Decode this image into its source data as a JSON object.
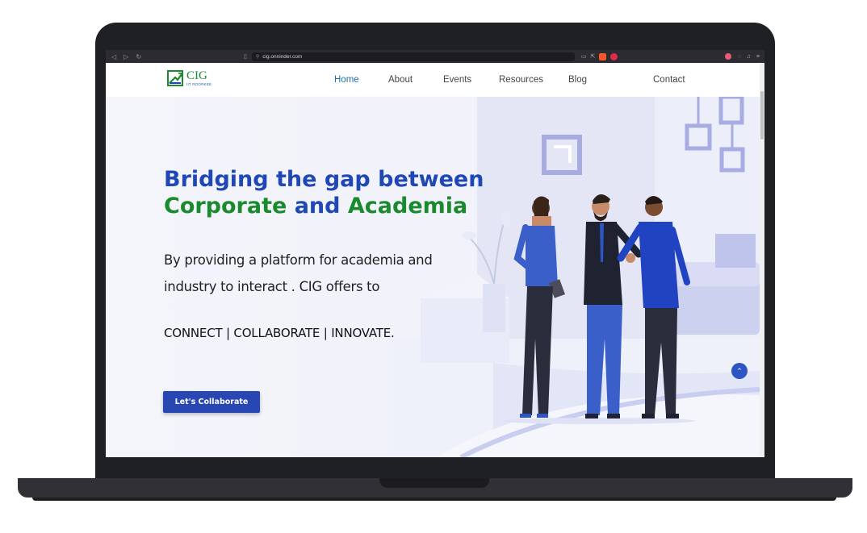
{
  "browser": {
    "url": "cig.onninder.com"
  },
  "site": {
    "logo_title": "CIG",
    "logo_subtitle": "IIT ROORKEE",
    "nav": [
      {
        "label": "Home",
        "active": true
      },
      {
        "label": "About",
        "active": false
      },
      {
        "label": "Events",
        "active": false
      },
      {
        "label": "Resources",
        "active": false
      },
      {
        "label": "Blog",
        "active": false
      },
      {
        "label": "Contact",
        "active": false
      }
    ]
  },
  "hero": {
    "title_line1": "Bridging the gap between",
    "title_corporate": "Corporate",
    "title_and": " and ",
    "title_academia": "Academia",
    "description": "By providing a platform for academia and industry to interact . CIG offers to",
    "tagline": "CONNECT | COLLABORATE | INNOVATE.",
    "cta_label": "Let's Collaborate"
  },
  "colors": {
    "brand_blue": "#1f47b5",
    "brand_green": "#1b8a2f",
    "nav_active": "#1e6fa8",
    "cta_bg": "#2947b3"
  },
  "icons": {
    "scroll_top": "chevron-up-icon"
  }
}
